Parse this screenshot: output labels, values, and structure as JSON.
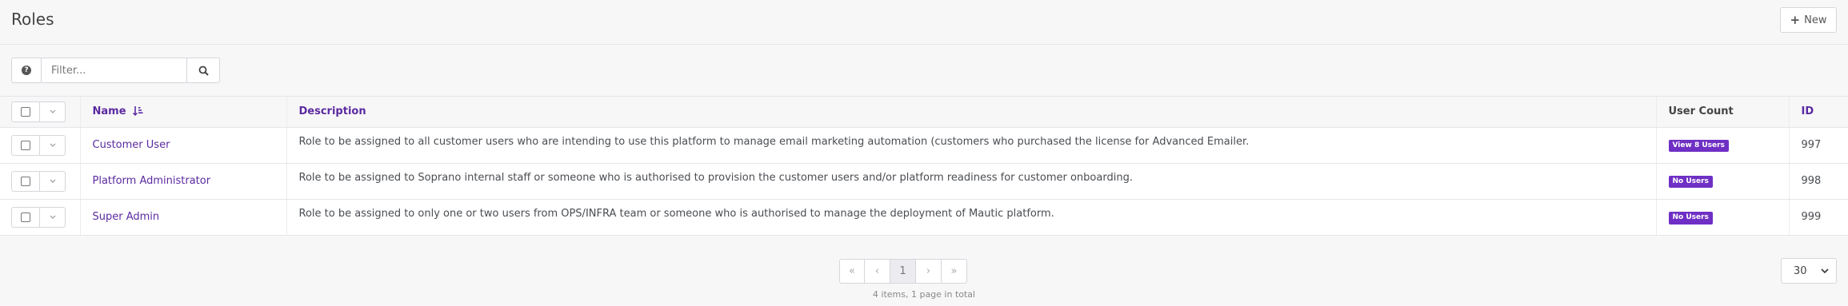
{
  "header": {
    "title": "Roles",
    "new_button": {
      "icon": "plus-icon",
      "label": "New"
    }
  },
  "filter": {
    "help_icon": "question-circle-icon",
    "placeholder": "Filter...",
    "value": "",
    "search_icon": "search-icon"
  },
  "table": {
    "columns": {
      "name": "Name",
      "description": "Description",
      "user_count": "User Count",
      "id": "ID"
    },
    "sort": {
      "column": "name",
      "direction": "ascending"
    },
    "rows": [
      {
        "name": "Customer User",
        "description": "Role to be assigned to all customer users who are intending to use this platform to manage email marketing automation (customers who purchased the license for Advanced Emailer.",
        "user_count": "View 8 Users",
        "id": "997"
      },
      {
        "name": "Platform Administrator",
        "description": "Role to be assigned to Soprano internal staff or someone who is authorised to provision the customer users and/or platform readiness for customer onboarding.",
        "user_count": "No Users",
        "id": "998"
      },
      {
        "name": "Super Admin",
        "description": "Role to be assigned to only one or two users from OPS/INFRA team or someone who is authorised to manage the deployment of Mautic platform.",
        "user_count": "No Users",
        "id": "999"
      }
    ]
  },
  "pagination": {
    "first": "«",
    "prev": "‹",
    "current_page": "1",
    "next": "›",
    "last": "»",
    "info": "4 items, 1 page in total",
    "limit": "30"
  },
  "colors": {
    "accent": "#5b2aa0",
    "badge": "#6f2fc4",
    "background": "#f7f7f8"
  }
}
